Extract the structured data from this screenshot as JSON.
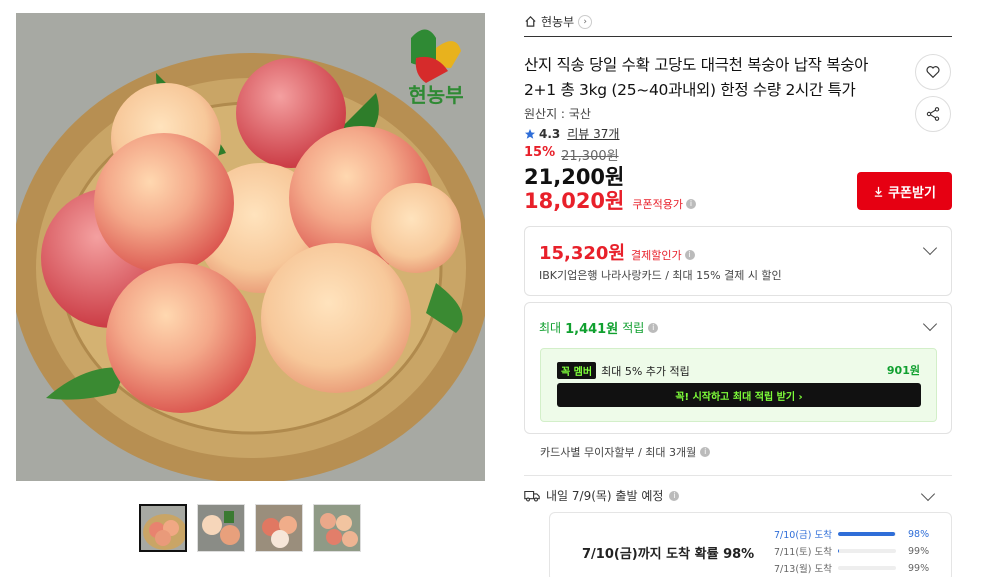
{
  "brand": {
    "name": "현농부",
    "logo_text": "현농부"
  },
  "product": {
    "title": "산지 직송 당일 수확 고당도 대극천 복숭아 납작 복숭아 2+1 총 3kg (25~40과내외) 한정 수량 2시간 특가",
    "origin": "원산지 : 국산",
    "rating": "4.3",
    "review_label": "리뷰 37개",
    "discount_pct": "15%",
    "original_price": "21,300원",
    "sale_price": "21,200원",
    "coupon_price": "18,020원",
    "coupon_applied_label": "쿠폰적용가"
  },
  "buttons": {
    "coupon": "쿠폰받기",
    "member_start": "꼭! 시작하고 최대 적립 받기  ›"
  },
  "payment": {
    "price": "15,320원",
    "label": "결제할인가",
    "note": "IBK기업은행 나라사랑카드 / 최대 15% 결제 시 할인"
  },
  "points": {
    "prefix": "최대",
    "amount": "1,441원",
    "suffix": "적립",
    "member_badge": "꼭 멤버",
    "member_text": "최대 5% 추가 적립",
    "member_amount": "901원"
  },
  "installment": "카드사별 무이자할부 / 최대 3개월",
  "shipping": {
    "label": "내일 7/9(목) 출발 예정",
    "arrival_main": "7/10(금)까지 도착 확률 98%",
    "rows": [
      {
        "date": "7/10(금) 도착",
        "pct": "98%",
        "fill": 0.98
      },
      {
        "date": "7/11(토) 도착",
        "pct": "99%",
        "fill": 0.01
      },
      {
        "date": "7/13(월) 도착",
        "pct": "99%",
        "fill": 0.0
      }
    ]
  },
  "colors": {
    "accent_red": "#e8202a",
    "point_green": "#10a02f",
    "member_lime": "#7fff3a",
    "arrival_blue": "#2f6ed8"
  },
  "icons": [
    "home-icon",
    "heart-icon",
    "share-icon",
    "star-icon",
    "download-icon",
    "truck-icon",
    "chevron-down-icon",
    "info-icon"
  ]
}
